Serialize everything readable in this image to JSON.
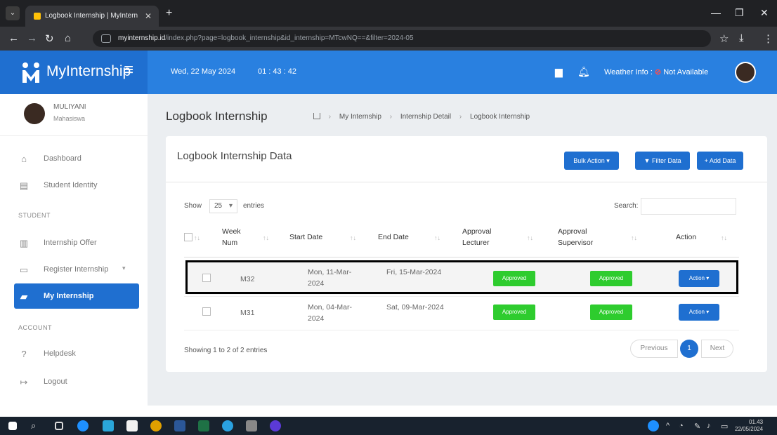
{
  "browser": {
    "tab_title": "Logbook Internship | MyIntern",
    "url_domain": "myinternship.id",
    "url_path": "/index.php?page=logbook_internship&id_internship=MTcwNQ==&filter=2024-05"
  },
  "header": {
    "brand": "MyInternship",
    "date": "Wed, 22 May 2024",
    "time": "01 : 43 : 42",
    "weather_label": "Weather Info :",
    "weather_value": "Not Available"
  },
  "sidebar": {
    "user_name": "MULIYANI",
    "user_role": "Mahasiswa",
    "items": [
      {
        "label": "Dashboard",
        "icon": "home-icon"
      },
      {
        "label": "Student Identity",
        "icon": "id-card-icon"
      },
      {
        "label": "Internship Offer",
        "icon": "building-icon"
      },
      {
        "label": "Register Internship",
        "icon": "form-icon"
      },
      {
        "label": "My Internship",
        "icon": "briefcase-icon"
      },
      {
        "label": "Helpdesk",
        "icon": "question-icon"
      },
      {
        "label": "Logout",
        "icon": "logout-icon"
      }
    ],
    "section_student": "STUDENT",
    "section_account": "ACCOUNT"
  },
  "page": {
    "title": "Logbook Internship",
    "breadcrumb": [
      "My Internship",
      "Internship Detail",
      "Logbook Internship"
    ]
  },
  "card": {
    "title": "Logbook Internship Data",
    "bulk_action": "Bulk Action",
    "filter_data": "Filter Data",
    "add_data": "+ Add Data",
    "show_label": "Show",
    "entries_value": "25",
    "entries_label": "entries",
    "search_label": "Search:",
    "columns": [
      "Week Num",
      "Start Date",
      "End Date",
      "Approval Lecturer",
      "Approval Supervisor",
      "Action"
    ],
    "rows": [
      {
        "week": "M32",
        "start": "Mon, 11-Mar-2024",
        "end": "Fri, 15-Mar-2024",
        "lecturer": "Approved",
        "supervisor": "Approved",
        "action": "Action"
      },
      {
        "week": "M31",
        "start": "Mon, 04-Mar-2024",
        "end": "Sat, 09-Mar-2024",
        "lecturer": "Approved",
        "supervisor": "Approved",
        "action": "Action"
      }
    ],
    "showing": "Showing 1 to 2 of 2 entries",
    "pagination": {
      "prev": "Previous",
      "current": "1",
      "next": "Next"
    }
  },
  "taskbar": {
    "clock_time": "01.43",
    "clock_date": "22/05/2024"
  },
  "colors": {
    "primary": "#1f6fd0",
    "header": "#2980e0",
    "approved": "#2ecc2e"
  }
}
